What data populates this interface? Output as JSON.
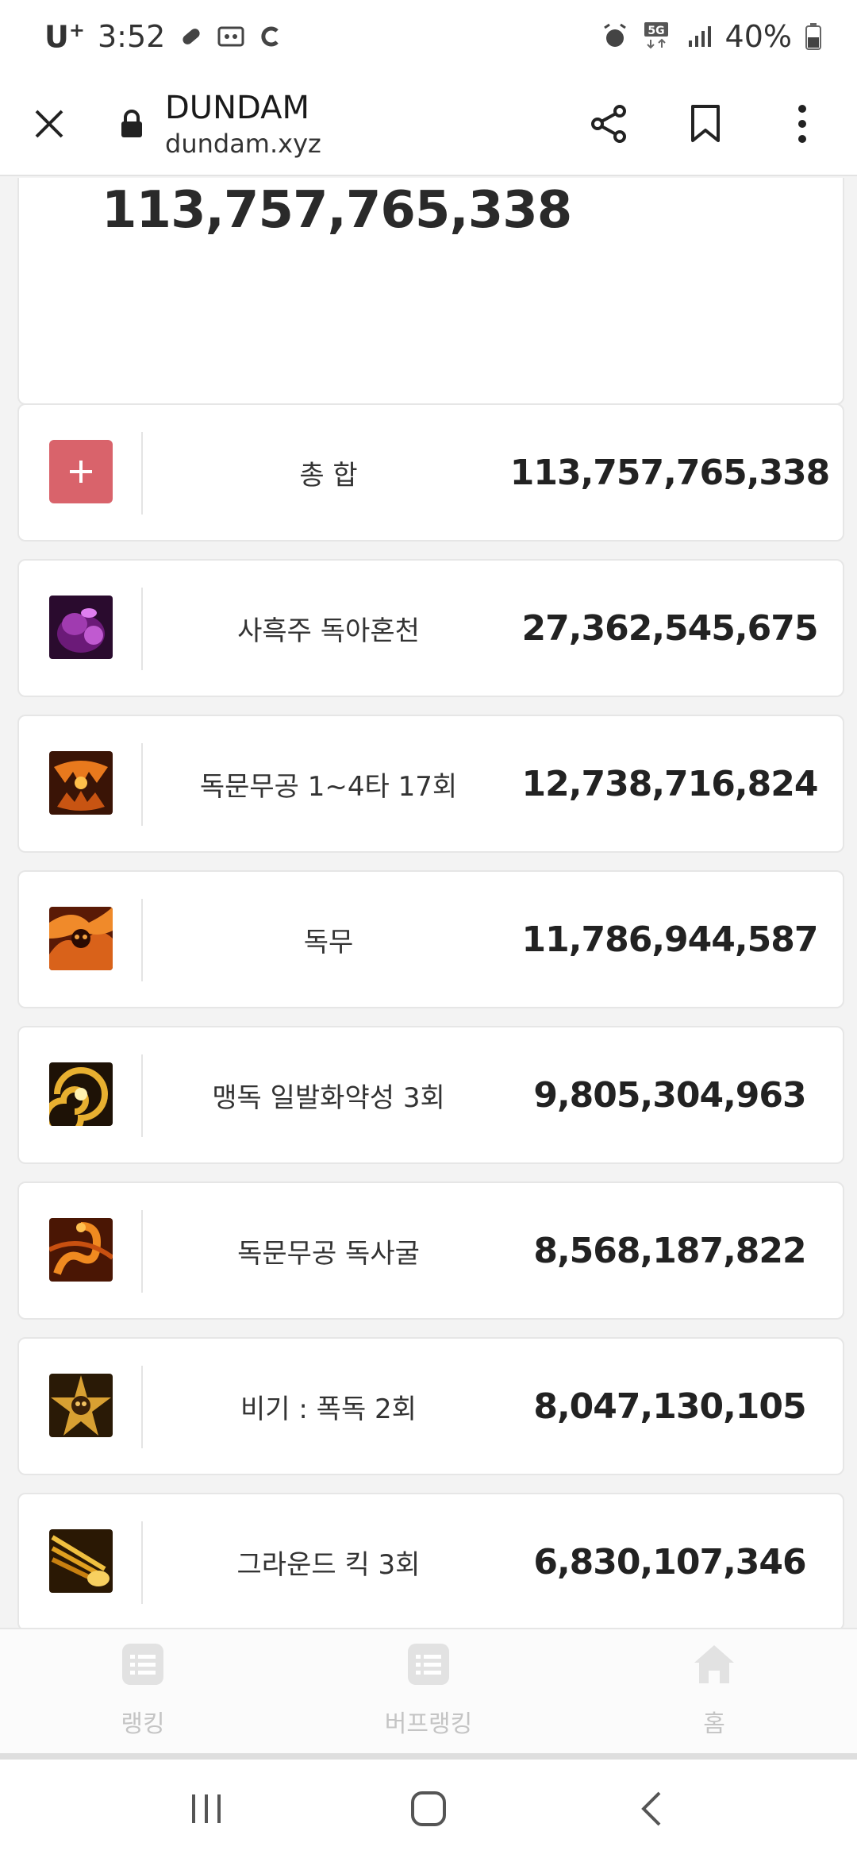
{
  "status_bar": {
    "carrier": "U",
    "carrier_sup": "+",
    "time": "3:52",
    "network": "5G",
    "battery": "40%"
  },
  "browser": {
    "title": "DUNDAM",
    "url": "dundam.xyz"
  },
  "total_card": {
    "value": "113,757,765,338"
  },
  "rows": [
    {
      "name": "총 합",
      "damage": "113,757,765,338",
      "icon": "plus-icon"
    },
    {
      "name": "사흑주 독아혼천",
      "damage": "27,362,545,675",
      "icon": "purple-skill-icon"
    },
    {
      "name": "독문무공 1~4타 17회",
      "damage": "12,738,716,824",
      "icon": "fang-skill-icon"
    },
    {
      "name": "독무",
      "damage": "11,786,944,587",
      "icon": "skull-flame-skill-icon"
    },
    {
      "name": "맹독 일발화약성 3회",
      "damage": "9,805,304,963",
      "icon": "swirl-skill-icon"
    },
    {
      "name": "독문무공 독사굴",
      "damage": "8,568,187,822",
      "icon": "snake-skill-icon"
    },
    {
      "name": "비기 : 폭독 2회",
      "damage": "8,047,130,105",
      "icon": "star-skull-skill-icon"
    },
    {
      "name": "그라운드 킥 3회",
      "damage": "6,830,107,346",
      "icon": "kick-skill-icon"
    }
  ],
  "tabs": [
    {
      "label": "랭킹",
      "icon": "list-icon"
    },
    {
      "label": "버프랭킹",
      "icon": "list-icon"
    },
    {
      "label": "홈",
      "icon": "home-icon"
    }
  ],
  "colors": {
    "plus_bg": "#d9636b",
    "tab_inactive": "#c4c4c4"
  }
}
